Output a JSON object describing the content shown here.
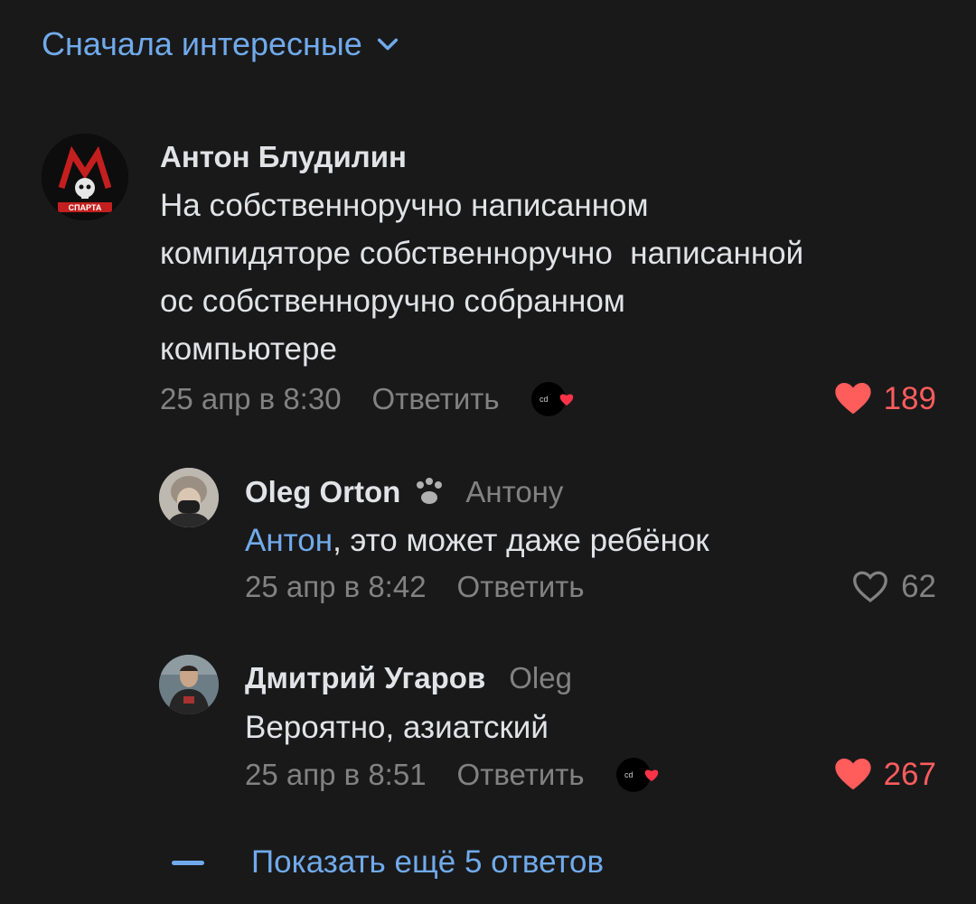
{
  "sort": {
    "label": "Сначала интересные"
  },
  "comments": [
    {
      "author": "Антон Блудилин",
      "avatar_text": "СПАРТА",
      "lines": [
        "На собственноручно написанном",
        "компидяторе собственноручно  написанной",
        "ос собственноручно собранном",
        "компьютере"
      ],
      "date": "25 апр в 8:30",
      "reply_label": "Ответить",
      "reaction_text": "cd",
      "likes": "189",
      "liked": true
    },
    {
      "author": "Oleg Orton",
      "reply_to": "Антону",
      "mention": "Антон",
      "text_rest": ", это может даже ребёнок",
      "date": "25 апр в 8:42",
      "reply_label": "Ответить",
      "likes": "62",
      "liked": false
    },
    {
      "author": "Дмитрий Угаров",
      "reply_to": "Oleg",
      "text": "Вероятно, азиатский",
      "date": "25 апр в 8:51",
      "reply_label": "Ответить",
      "reaction_text": "cd",
      "likes": "267",
      "liked": true
    }
  ],
  "show_more": "Показать ещё 5 ответов",
  "colors": {
    "accent": "#71aaeb",
    "like": "#ff5c5c",
    "background": "#19191a",
    "secondary": "#828282"
  }
}
